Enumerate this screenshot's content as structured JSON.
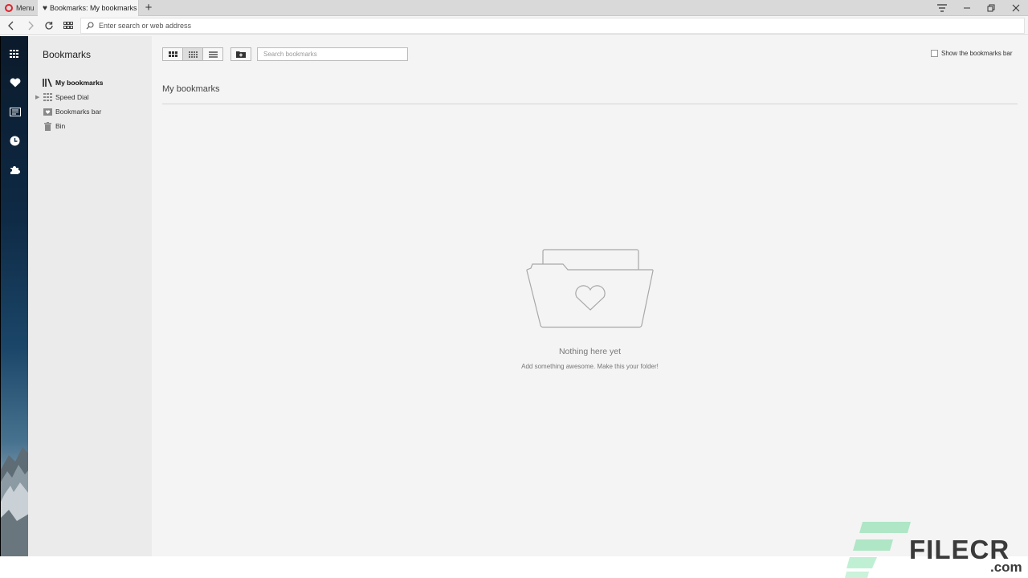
{
  "tabstrip": {
    "menu_label": "Menu",
    "active_tab_title": "Bookmarks: My bookmarks",
    "new_tab_glyph": "+",
    "controls": {
      "tabs_menu": "tab-menu-icon",
      "minimize": "minimize-icon",
      "restore": "restore-icon",
      "close": "close-icon"
    }
  },
  "addressbar": {
    "placeholder": "Enter search or web address",
    "value": ""
  },
  "sidebar": {
    "items": [
      "speed-dial-icon",
      "bookmarks-heart-icon",
      "news-icon",
      "history-clock-icon",
      "extensions-puzzle-icon"
    ]
  },
  "bookmarks_panel": {
    "title": "Bookmarks",
    "tree": [
      {
        "label": "My bookmarks",
        "icon": "library-icon",
        "active": true
      },
      {
        "label": "Speed Dial",
        "icon": "speed-dial-grid-icon",
        "expandable": true
      },
      {
        "label": "Bookmarks bar",
        "icon": "bookmarks-bar-icon"
      },
      {
        "label": "Bin",
        "icon": "trash-icon"
      }
    ]
  },
  "main": {
    "view_modes": [
      "large-tiles",
      "small-tiles",
      "list"
    ],
    "selected_view": "small-tiles",
    "search_placeholder": "Search bookmarks",
    "show_bar_label": "Show the bookmarks bar",
    "show_bar_checked": false,
    "folder_heading": "My bookmarks",
    "empty_title": "Nothing here yet",
    "empty_subtitle": "Add something awesome. Make this your folder!"
  },
  "watermark": {
    "text": "FILECR",
    "domain": ".com"
  },
  "colors": {
    "opera_red": "#e0202a",
    "watermark_green": "#2ecc71"
  }
}
